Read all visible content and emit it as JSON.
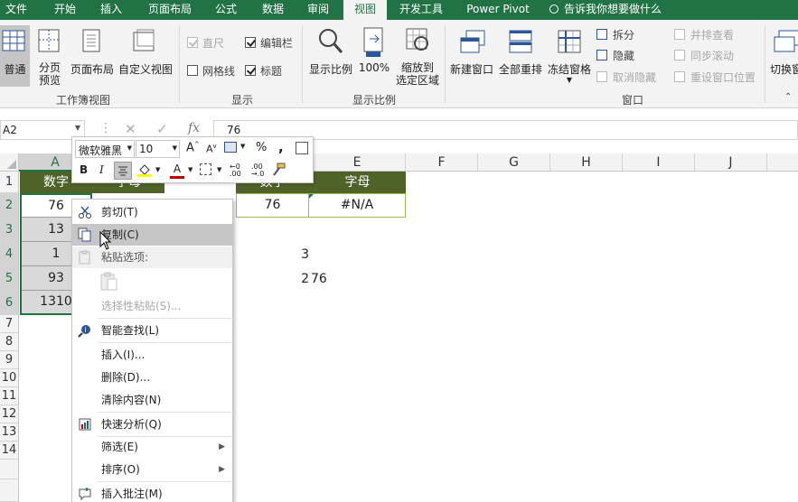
{
  "tabs": [
    "文件",
    "开始",
    "插入",
    "页面布局",
    "公式",
    "数据",
    "审阅",
    "视图",
    "开发工具",
    "Power Pivot"
  ],
  "active_tab": "视图",
  "tell_me": "告诉我你想要做什么",
  "ribbon": {
    "workbook_views": {
      "normal": "普通",
      "page_break": "分页\n预览",
      "page_layout": "页面布局",
      "custom": "自定义视图",
      "group": "工作簿视图"
    },
    "show": {
      "ruler": "直尺",
      "formula_bar": "编辑栏",
      "gridlines": "网格线",
      "headings": "标题",
      "group": "显示"
    },
    "zoom": {
      "zoom": "显示比例",
      "hundred": "100%",
      "to_selection": "缩放到\n选定区域",
      "group": "显示比例"
    },
    "window": {
      "new_window": "新建窗口",
      "arrange_all": "全部重排",
      "freeze": "冻结窗格",
      "split": "拆分",
      "hide": "隐藏",
      "unhide": "取消隐藏",
      "side_by_side": "并排查看",
      "sync_scroll": "同步滚动",
      "reset_pos": "重设窗口位置",
      "switch": "切换窗",
      "group": "窗口"
    }
  },
  "formula_bar": {
    "name_box": "A2",
    "value": "76"
  },
  "mini_toolbar": {
    "font": "微软雅黑",
    "size": "10",
    "percent": "%",
    "comma": ","
  },
  "columns": [
    "A",
    "B",
    "C",
    "D",
    "E",
    "F",
    "G",
    "H",
    "I",
    "J"
  ],
  "rows": [
    "1",
    "2",
    "3",
    "4",
    "5",
    "6",
    "7",
    "8",
    "9",
    "10",
    "11",
    "12",
    "13",
    "14"
  ],
  "cells": {
    "a1": "数字",
    "b1": "字母",
    "d1": "数字",
    "e1": "字母",
    "a2": "76",
    "a3": "13",
    "a4": "1",
    "a5": "93",
    "a6": "1310",
    "d2": "76",
    "e2": "#N/A",
    "d4": "3",
    "d5a": "2",
    "d5b": "76"
  },
  "context_menu": {
    "cut": "剪切(T)",
    "copy": "复制(C)",
    "paste_options": "粘贴选项:",
    "paste_special": "选择性粘贴(S)...",
    "smart_lookup": "智能查找(L)",
    "insert": "插入(I)...",
    "delete": "删除(D)...",
    "clear": "清除内容(N)",
    "quick_analysis": "快速分析(Q)",
    "filter": "筛选(E)",
    "sort": "排序(O)",
    "comment": "插入批注(M)"
  },
  "colors": {
    "brand": "#217346",
    "header_fill": "#4f6228",
    "header_text": "#ffffff"
  }
}
